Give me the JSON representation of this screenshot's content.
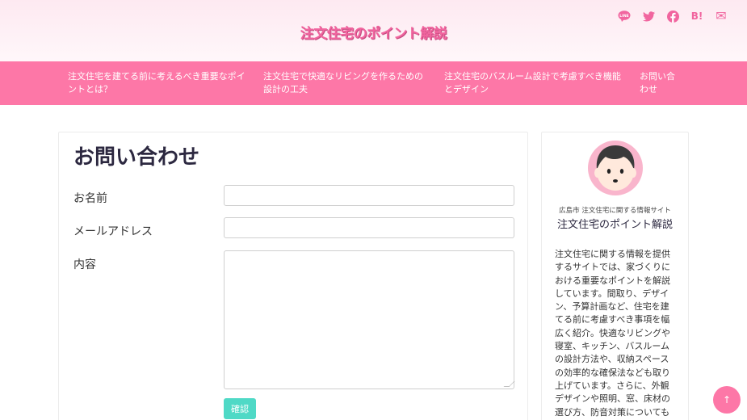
{
  "header": {
    "site_title": "注文住宅のポイント解説",
    "social_icons": [
      {
        "name": "line-icon",
        "glyph": "LINE"
      },
      {
        "name": "twitter-icon",
        "glyph": "🐦"
      },
      {
        "name": "facebook-icon",
        "glyph": "f"
      },
      {
        "name": "hatena-bookmark-icon",
        "glyph": "B!"
      },
      {
        "name": "mail-icon",
        "glyph": "✉"
      }
    ]
  },
  "nav": {
    "items": [
      {
        "label": "注文住宅を建てる前に考えるべき重要なポイントとは？"
      },
      {
        "label": "注文住宅で快適なリビングを作るための設計の工夫"
      },
      {
        "label": "注文住宅のバスルーム設計で考慮すべき機能とデザイン"
      },
      {
        "label": "お問い合わせ"
      }
    ]
  },
  "main": {
    "page_title": "お問い合わせ",
    "fields": {
      "name_label": "お名前",
      "email_label": "メールアドレス",
      "content_label": "内容"
    },
    "confirm_label": "確認"
  },
  "sidebar": {
    "subtitle": "広島市 注文住宅に関する情報サイト",
    "title": "注文住宅のポイント解説",
    "description": "注文住宅に関する情報を提供するサイトでは、家づくりにおける重要なポイントを解説しています。間取り、デザイン、予算計画など、住宅を建てる前に考慮すべき事項を幅広く紹介。快適なリビングや寝室、キッチン、バスルームの設計方法や、収納スペースの効率的な確保法なども取り上げています。さらに、外観デザインや照明、窓、床材の選び方、防音対策についても"
  },
  "scroll_top": {
    "glyph": "↑"
  },
  "colors": {
    "accent": "#fd77a7",
    "button": "#4fd9c6",
    "title_pink": "#f1659f"
  }
}
